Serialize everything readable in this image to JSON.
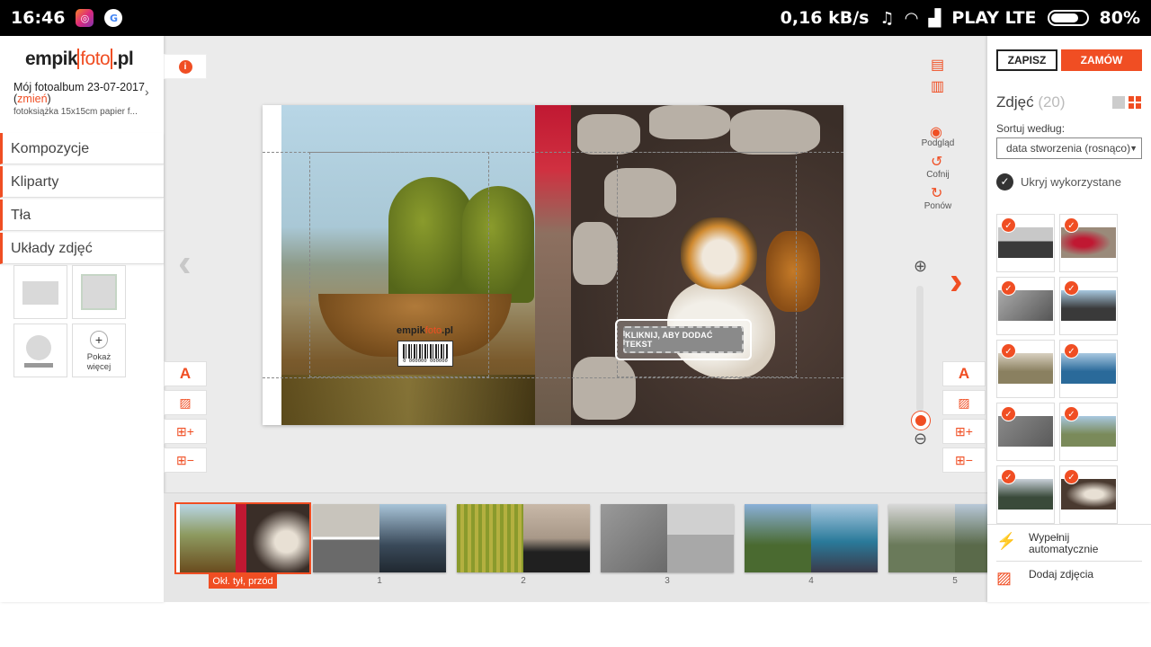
{
  "status_bar": {
    "time": "16:46",
    "network_speed": "0,16 kB/s",
    "carrier": "PLAY LTE",
    "battery": "80%",
    "icons": [
      "instagram-icon",
      "google-icon",
      "headphones-icon",
      "wifi-icon",
      "signal-icon",
      "battery-icon"
    ]
  },
  "app": {
    "logo_left": "empik",
    "logo_mid": "foto",
    "logo_right": ".pl"
  },
  "album": {
    "title": "Mój fotoalbum 23-07-2017",
    "change_open": "(",
    "change_link": "zmień",
    "change_close": ")",
    "subtitle": "fotoksiążka 15x15cm papier f..."
  },
  "left_menu": {
    "items": [
      {
        "label": "Kompozycje"
      },
      {
        "label": "Kliparty"
      },
      {
        "label": "Tła"
      },
      {
        "label": "Układy zdjęć"
      }
    ],
    "show_more_plus": "+",
    "show_more_l1": "Pokaż",
    "show_more_l2": "więcej"
  },
  "toolbar_left": {
    "info": "i",
    "text_tool": "A"
  },
  "toolbar_right": {
    "preview": "Podgląd",
    "undo": "Cofnij",
    "redo": "Ponów",
    "text_tool": "A"
  },
  "spread": {
    "cover_logo_left": "empik",
    "cover_logo_mid": "foto",
    "cover_logo_right": ".pl",
    "barcode_number": "0 000000 000000",
    "text_prompt": "KLIKNIJ, ABY DODAĆ TEKST"
  },
  "thumbnails": {
    "items": [
      {
        "label": "Okł. tył, przód",
        "selected": true
      },
      {
        "label": "1"
      },
      {
        "label": "2"
      },
      {
        "label": "3"
      },
      {
        "label": "4"
      },
      {
        "label": "5"
      }
    ]
  },
  "right_panel": {
    "save_label": "ZAPISZ",
    "order_label": "ZAMÓW",
    "photos_title": "Zdjęć",
    "photos_count": "(20)",
    "sort_label": "Sortuj według:",
    "sort_value": "data stworzenia (rosnąco)",
    "hide_used": "Ukryj wykorzystane",
    "autofill_l1": "Wypełnij",
    "autofill_l2": "automatycznie",
    "add_photos": "Dodaj zdjęcia"
  },
  "colors": {
    "accent": "#f04e23",
    "panel_bg": "#ffffff",
    "workspace_bg": "#ebebeb"
  }
}
